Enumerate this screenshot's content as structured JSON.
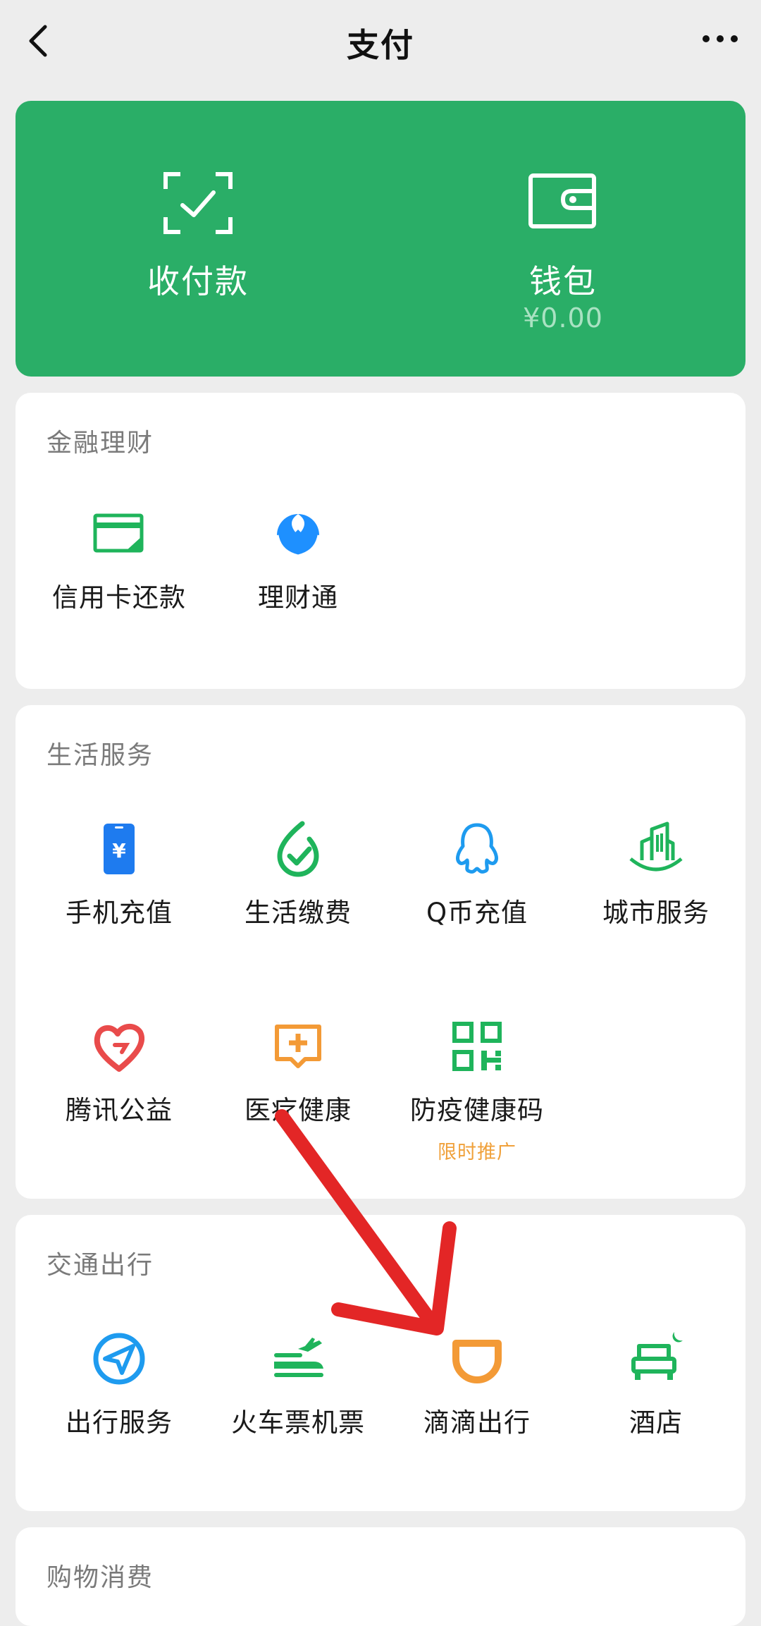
{
  "nav": {
    "title": "支付"
  },
  "hero": {
    "pay": {
      "label": "收付款"
    },
    "wallet": {
      "label": "钱包",
      "balance": "¥0.00"
    }
  },
  "sections": [
    {
      "title": "金融理财",
      "items": [
        {
          "label": "信用卡还款",
          "icon": "credit-card-icon",
          "color": "#1fb45b"
        },
        {
          "label": "理财通",
          "icon": "wealth-icon",
          "color": "#1e90ff"
        }
      ]
    },
    {
      "title": "生活服务",
      "items": [
        {
          "label": "手机充值",
          "icon": "phone-recharge-icon",
          "color": "#1e7bef"
        },
        {
          "label": "生活缴费",
          "icon": "utility-payment-icon",
          "color": "#1fb45b"
        },
        {
          "label": "Q币充值",
          "icon": "qq-penguin-icon",
          "color": "#1e9bef"
        },
        {
          "label": "城市服务",
          "icon": "city-service-icon",
          "color": "#1fb45b"
        },
        {
          "label": "腾讯公益",
          "icon": "charity-heart-icon",
          "color": "#e94b4b"
        },
        {
          "label": "医疗健康",
          "icon": "medical-icon",
          "color": "#f39a36"
        },
        {
          "label": "防疫健康码",
          "icon": "qr-code-icon",
          "color": "#1fb45b",
          "tag": "限时推广"
        }
      ]
    },
    {
      "title": "交通出行",
      "items": [
        {
          "label": "出行服务",
          "icon": "navigation-icon",
          "color": "#1e9bef"
        },
        {
          "label": "火车票机票",
          "icon": "train-plane-icon",
          "color": "#1fb45b"
        },
        {
          "label": "滴滴出行",
          "icon": "didi-icon",
          "color": "#f39a36"
        },
        {
          "label": "酒店",
          "icon": "hotel-bed-icon",
          "color": "#1fb45b"
        }
      ]
    },
    {
      "title": "购物消费",
      "items": []
    }
  ],
  "colors": {
    "hero_green": "#2aae67",
    "background": "#ededed",
    "annotation_arrow": "#e32626",
    "promo_tag": "#f0a13b"
  }
}
